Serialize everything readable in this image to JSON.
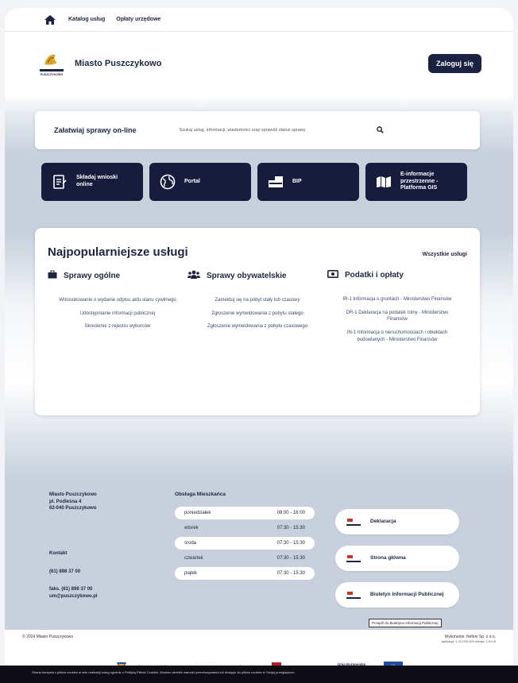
{
  "topnav": {
    "home_icon": "home-icon",
    "links": [
      "Katalog usług",
      "Opłaty urzędowe"
    ]
  },
  "header": {
    "brand": "Miasto Puszczykowo",
    "logo_caption": "PUSZCZYKOWO",
    "login": "Zaloguj się"
  },
  "search": {
    "title": "Załatwiaj sprawy on-line",
    "placeholder": "Szukaj usług, informacji, wiadomości oraz sprawdź status sprawy",
    "icon": "search-icon"
  },
  "tiles": [
    {
      "icon": "form-icon",
      "label": "Składaj wnioski online"
    },
    {
      "icon": "globe-icon",
      "label": "Portal"
    },
    {
      "icon": "bip-icon",
      "label": "BIP"
    },
    {
      "icon": "map-icon",
      "label": "E-informacje przestrzenne - Platforma GIS"
    }
  ],
  "popular": {
    "title": "Najpopularniejsze usługi",
    "all_link": "Wszystkie usługi",
    "columns": [
      {
        "icon": "briefcase-icon",
        "title": "Sprawy ogólne",
        "items": [
          "Wniosokowanie o wydanie odpisu aktu stanu cywilnego",
          "Udostępnianie informacji publicznej",
          "Skreślenie z rejestru wyborców"
        ]
      },
      {
        "icon": "people-icon",
        "title": "Sprawy obywatelskie",
        "items": [
          "Zamelduj się na pobyt stały lub czasowy",
          "Zgłoszenie wymeldowania z pobytu stałego",
          "Zgłoszenie wymeldowania z pobytu czasowego"
        ]
      },
      {
        "icon": "money-icon",
        "title": "Podatki i opłaty",
        "items": [
          "IR-1 Informacja o gruntach - Ministerstwo Finansów",
          "DR-1 Deklaracja na podatek rolny - Ministerstwo Finansów",
          "IN-1 Informacja o nieruchomościach i obiektach budowlanych - Ministerstwo Finansów"
        ]
      }
    ]
  },
  "footer": {
    "address": [
      "Miasto Puszczykowo",
      "pl. Podleśna 4",
      "62-040 Puszczykowo"
    ],
    "contact_title": "Kontakt",
    "phone": "(61) 898 37 00",
    "fax": "faks. (61) 898 37 00",
    "email": "um@puszczykowo.pl",
    "hours_title": "Obsługa Mieszkańca",
    "hours": [
      {
        "day": "poniedziałek",
        "time": "08:00 - 16:00"
      },
      {
        "day": "wtorek",
        "time": "07:30 - 15:30"
      },
      {
        "day": "środa",
        "time": "07:30 - 15:30"
      },
      {
        "day": "czwartek",
        "time": "07:30 - 15:30"
      },
      {
        "day": "piątek",
        "time": "07:30 - 15:30"
      }
    ],
    "links": [
      "Deklaracja",
      "Strona główna",
      "Biuletyn Informacji Publicznej"
    ],
    "tooltip": "Przejdź do Biuletynu Informacji Publicznej"
  },
  "bottom": {
    "copyright": "© 2024 Miasto Puszczykowo",
    "made_by": "Wykonanie: Nefeni Sp. z o.o.",
    "version": "aplikacja: 1.10.000.000 wersja: 1.8.5.8",
    "funds": [
      {
        "icon": "eu-funds-icon",
        "label": "Fundusze Europejskie Program Regionalny"
      },
      {
        "icon": "pl-flag-icon",
        "label": "Rzeczpospolita Polska"
      },
      {
        "icon": "wielkopolska-icon",
        "label": "Samorząd Województwa Wielkopolskiego"
      },
      {
        "icon": "eu-flag-icon",
        "label": "Unia Europejska Europejski Fundusz Rozwoju Regionalnego"
      }
    ]
  },
  "cookie_text": "Strona korzysta z plików cookies w celu realizacji usług zgodnie z Polityką Plików Cookies. Możesz określić warunki przechowywania lub dostępu do plików cookies w Twojej przeglądarce."
}
